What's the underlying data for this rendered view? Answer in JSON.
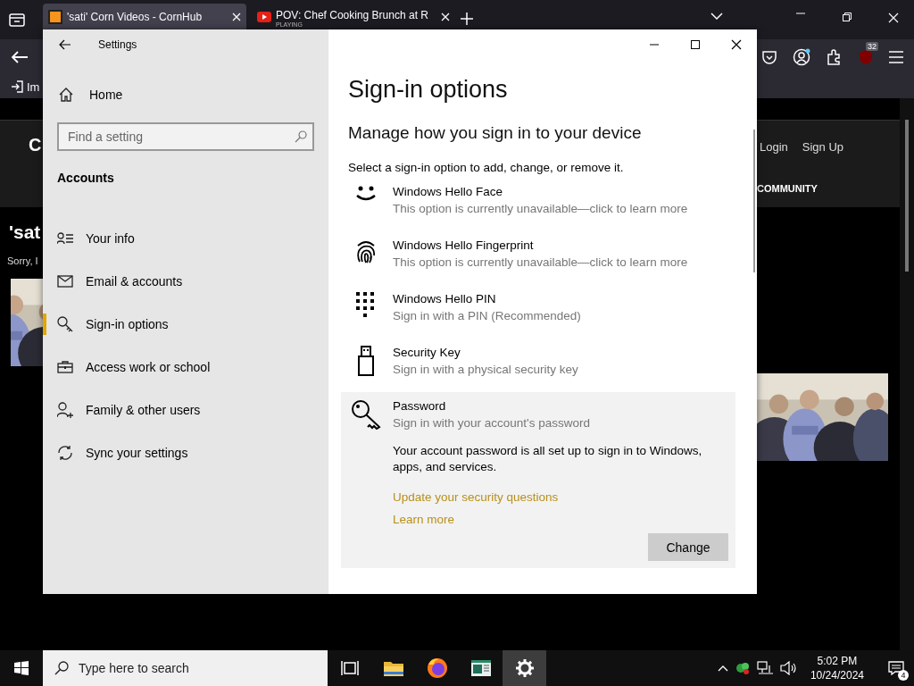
{
  "browser": {
    "tabs": [
      {
        "title": "'sati' Corn Videos - CornHub",
        "kind": "site",
        "selected": true
      },
      {
        "title": "POV: Chef Cooking Brunch at R",
        "status": "PLAYING",
        "kind": "video",
        "selected": false
      }
    ],
    "extension_badge": "32",
    "bookmark": "Im",
    "page": {
      "logo": "C",
      "heading": "'sat",
      "message": "Sorry, I",
      "nav": [
        "Login",
        "Sign Up"
      ],
      "category": "COMMUNITY"
    }
  },
  "settings": {
    "title": "Settings",
    "home": "Home",
    "search": {
      "placeholder": "Find a setting"
    },
    "section": "Accounts",
    "nav": [
      {
        "label": "Your info",
        "kind": "person",
        "selected": false
      },
      {
        "label": "Email & accounts",
        "kind": "mail",
        "selected": false
      },
      {
        "label": "Sign-in options",
        "kind": "key",
        "selected": true
      },
      {
        "label": "Access work or school",
        "kind": "briefcase",
        "selected": false
      },
      {
        "label": "Family & other users",
        "kind": "family",
        "selected": false
      },
      {
        "label": "Sync your settings",
        "kind": "sync",
        "selected": false
      }
    ],
    "page_title": "Sign-in options",
    "subtitle": "Manage how you sign in to your device",
    "instruction": "Select a sign-in option to add, change, or remove it.",
    "options": [
      {
        "kind": "face",
        "title": "Windows Hello Face",
        "description": "This option is currently unavailable—click to learn more",
        "expanded": false
      },
      {
        "kind": "fingerprint",
        "title": "Windows Hello Fingerprint",
        "description": "This option is currently unavailable—click to learn more",
        "expanded": false
      },
      {
        "kind": "pin",
        "title": "Windows Hello PIN",
        "description": "Sign in with a PIN (Recommended)",
        "expanded": false
      },
      {
        "kind": "usb",
        "title": "Security Key",
        "description": "Sign in with a physical security key",
        "expanded": false
      },
      {
        "kind": "password",
        "title": "Password",
        "description": "Sign in with your account's password",
        "expanded": true,
        "details": "Your account password is all set up to sign in to Windows, apps, and services.",
        "links": [
          "Update your security questions",
          "Learn more"
        ],
        "button": "Change"
      }
    ]
  },
  "taskbar": {
    "search": {
      "placeholder": "Type here to search"
    },
    "apps": [
      {
        "kind": "task-view",
        "active": false
      },
      {
        "kind": "folder",
        "active": false
      },
      {
        "kind": "browser",
        "active": false
      },
      {
        "kind": "app",
        "active": false
      },
      {
        "kind": "settings",
        "active": true
      }
    ],
    "time": "5:02 PM",
    "date": "10/24/2024",
    "notifications": "4"
  }
}
